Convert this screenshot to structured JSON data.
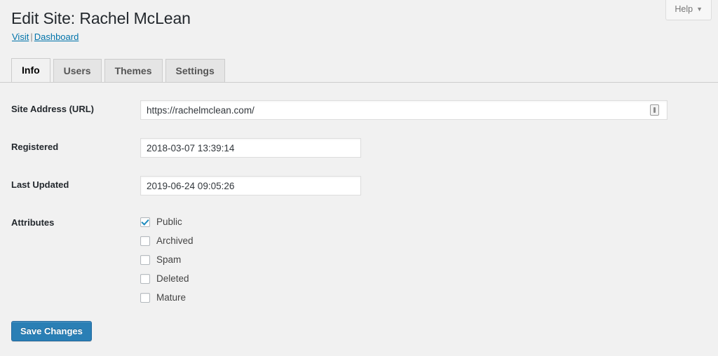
{
  "header": {
    "title": "Edit Site: Rachel McLean",
    "links": [
      {
        "label": "Visit"
      },
      {
        "label": "Dashboard"
      }
    ],
    "link_separator": "|",
    "help_label": "Help",
    "help_caret": "▼"
  },
  "tabs": [
    {
      "label": "Info",
      "active": true
    },
    {
      "label": "Users",
      "active": false
    },
    {
      "label": "Themes",
      "active": false
    },
    {
      "label": "Settings",
      "active": false
    }
  ],
  "form": {
    "site_address": {
      "label": "Site Address (URL)",
      "value": "https://rachelmclean.com/",
      "icon": "autofill-icon"
    },
    "registered": {
      "label": "Registered",
      "value": "2018-03-07 13:39:14"
    },
    "last_updated": {
      "label": "Last Updated",
      "value": "2019-06-24 09:05:26"
    },
    "attributes": {
      "label": "Attributes",
      "options": [
        {
          "label": "Public",
          "checked": true
        },
        {
          "label": "Archived",
          "checked": false
        },
        {
          "label": "Spam",
          "checked": false
        },
        {
          "label": "Deleted",
          "checked": false
        },
        {
          "label": "Mature",
          "checked": false
        }
      ]
    }
  },
  "actions": {
    "save_label": "Save Changes"
  },
  "colors": {
    "accent": "#0073aa",
    "primary_button": "#2a7fb5",
    "checkbox_check": "#1e8cbe",
    "background": "#f1f1f1"
  }
}
